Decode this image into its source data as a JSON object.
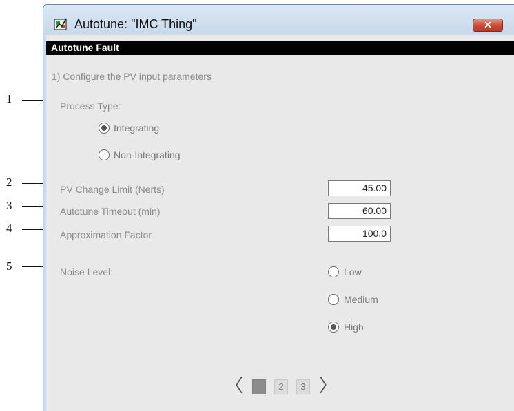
{
  "callouts": [
    "1",
    "2",
    "3",
    "4",
    "5"
  ],
  "window": {
    "title": "Autotune:  \"IMC Thing\"",
    "close_label": "✕"
  },
  "header": "Autotune Fault",
  "step_instruction": "1) Configure the PV input parameters",
  "process_type": {
    "label": "Process Type:",
    "options": [
      {
        "label": "Integrating",
        "selected": true
      },
      {
        "label": "Non-Integrating",
        "selected": false
      }
    ]
  },
  "fields": [
    {
      "label": "PV Change Limit (Nerts)",
      "value": "45.00"
    },
    {
      "label": "Autotune Timeout (min)",
      "value": "60.00"
    },
    {
      "label": "Approximation Factor",
      "value": "100.0"
    }
  ],
  "noise_level": {
    "label": "Noise Level:",
    "options": [
      {
        "label": "Low",
        "selected": false
      },
      {
        "label": "Medium",
        "selected": false
      },
      {
        "label": "High",
        "selected": true
      }
    ]
  },
  "pager": {
    "prev": "〈",
    "next": "〉",
    "pages": [
      "1",
      "2",
      "3"
    ],
    "current_page": "1"
  },
  "colors": {
    "header_bar": "#000000",
    "close_button": "#c94a36",
    "panel": "#e9e9e9"
  }
}
